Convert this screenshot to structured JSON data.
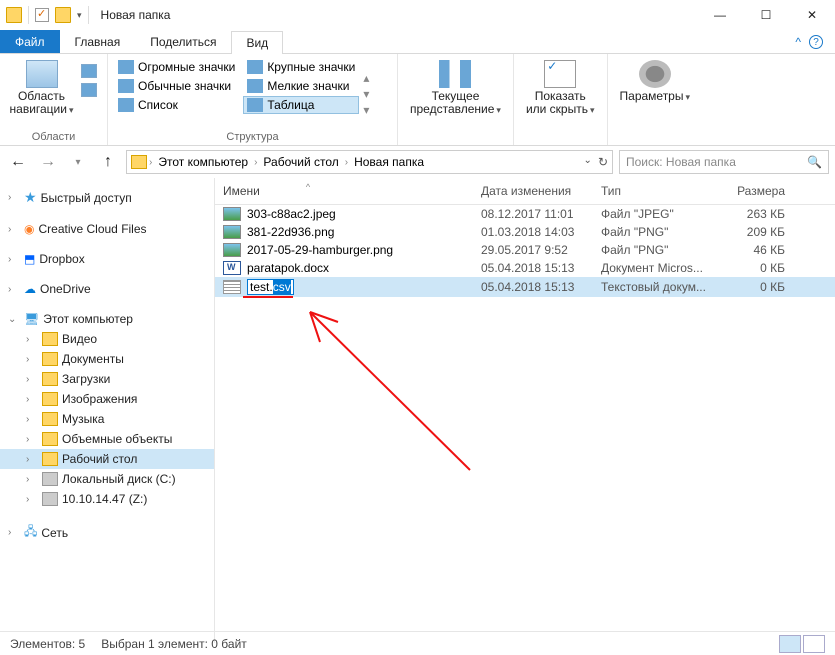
{
  "window": {
    "title": "Новая папка"
  },
  "tabs": {
    "file": "Файл",
    "home": "Главная",
    "share": "Поделиться",
    "view": "Вид"
  },
  "ribbon": {
    "nav_pane": "Область\nнавигации",
    "icons": {
      "huge": "Огромные значки",
      "large": "Крупные значки",
      "normal": "Обычные значки",
      "small": "Мелкие значки",
      "list": "Список",
      "table": "Таблица"
    },
    "group_layout": "Структура",
    "current_view": "Текущее\nпредставление",
    "show_hide": "Показать\nили скрыть",
    "options": "Параметры"
  },
  "breadcrumb": [
    "Этот компьютер",
    "Рабочий стол",
    "Новая папка"
  ],
  "search_placeholder": "Поиск: Новая папка",
  "tree": {
    "quick": "Быстрый доступ",
    "ccf": "Creative Cloud Files",
    "dropbox": "Dropbox",
    "onedrive": "OneDrive",
    "thispc": "Этот компьютер",
    "video": "Видео",
    "docs": "Документы",
    "downloads": "Загрузки",
    "pictures": "Изображения",
    "music": "Музыка",
    "objects3d": "Объемные объекты",
    "desktop": "Рабочий стол",
    "diskc": "Локальный диск (C:)",
    "netdisk": "10.10.14.47 (Z:)",
    "network": "Сеть"
  },
  "columns": {
    "name": "Имени",
    "date": "Дата изменения",
    "type": "Тип",
    "size": "Размера"
  },
  "files": [
    {
      "name": "303-c88ac2.jpeg",
      "date": "08.12.2017 11:01",
      "type": "Файл \"JPEG\"",
      "size": "263 КБ",
      "icon": "img"
    },
    {
      "name": "381-22d936.png",
      "date": "01.03.2018 14:03",
      "type": "Файл \"PNG\"",
      "size": "209 КБ",
      "icon": "img"
    },
    {
      "name": "2017-05-29-hamburger.png",
      "date": "29.05.2017 9:52",
      "type": "Файл \"PNG\"",
      "size": "46 КБ",
      "icon": "img"
    },
    {
      "name": "paratapok.docx",
      "date": "05.04.2018 15:13",
      "type": "Документ Micros...",
      "size": "0 КБ",
      "icon": "doc"
    },
    {
      "name_base": "test.",
      "name_sel": "csv",
      "date": "05.04.2018 15:13",
      "type": "Текстовый докум...",
      "size": "0 КБ",
      "icon": "txt",
      "renaming": true
    }
  ],
  "status": {
    "count": "Элементов: 5",
    "selection": "Выбран 1 элемент: 0 байт"
  }
}
